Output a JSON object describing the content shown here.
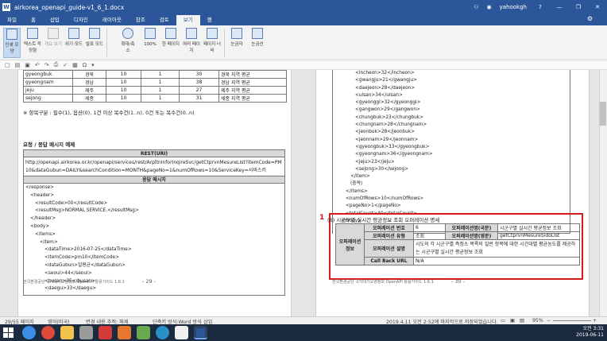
{
  "window": {
    "title": "airkorea_openapi_guide-v1_6_1.docx",
    "user": "yahookgh",
    "help": "?",
    "minimize": "—",
    "restore": "❐",
    "close": "✕"
  },
  "tabs": [
    "파일",
    "홈",
    "삽입",
    "디자인",
    "레이아웃",
    "참조",
    "검토",
    "보기",
    "펜"
  ],
  "ribbon": {
    "buttons": [
      {
        "label": "인쇄 모양",
        "state": "active"
      },
      {
        "label": "텍스트 작정형",
        "state": ""
      },
      {
        "label": "개요 보기",
        "state": "dim"
      },
      {
        "label": "위기 모드",
        "state": ""
      },
      {
        "label": "발표 모드",
        "state": ""
      },
      {
        "label": "확대/축소",
        "state": ""
      },
      {
        "label": "100%",
        "state": ""
      },
      {
        "label": "한 페이지",
        "state": ""
      },
      {
        "label": "여러 페이지",
        "state": ""
      },
      {
        "label": "페이지 너비",
        "state": ""
      },
      {
        "label": "눈금자",
        "state": ""
      },
      {
        "label": "눈금선",
        "state": ""
      }
    ]
  },
  "toptable": {
    "rows": [
      [
        "gyeongbuk",
        "경북",
        "10",
        "1",
        "30",
        "경북 지역 평균"
      ],
      [
        "gyeongnam",
        "경남",
        "10",
        "1",
        "38",
        "경남 지역 평균"
      ],
      [
        "jeju",
        "제주",
        "10",
        "1",
        "27",
        "제주 지역 평균"
      ],
      [
        "sejong",
        "세종",
        "10",
        "1",
        "31",
        "세종 지역 평균"
      ]
    ]
  },
  "page1": {
    "note": "※ 항목구분 : 필수(1), 옵션(0), 1건 이상 복수건(1..n), 0건 또는 복수건(0..n)",
    "heading": "요청 / 응답 메시지 예제",
    "rest_header": "REST(URI)",
    "url": "http://openapi.airkorea.or.kr/openapi/services/rest/ArpltnInforInqireSvc/getCtprvnMesureLIst?itemCode=PM10&dataGubun=DAILY&searchCondition=MONTH&pageNo=1&numOfRows=10&ServiceKey=서비스키",
    "resp_header": "응답 메시지",
    "response": [
      "<response>",
      "  <header>",
      "    <resultCode>00</resultCode>",
      "    <resultMsg>NORMAL SERVICE.</resultMsg>",
      "  </header>",
      "  <body>",
      "    <items>",
      "      <item>",
      "        <dataTime>2016-07-25</dataTime>",
      "        <itemCode>pm10</itemCode>",
      "        <dataGubun>일평균</dataGubun>",
      "        <seoul>44</seoul>",
      "        <busan>35</busan>",
      "        <daegu>33</daegu>"
    ],
    "footer": "한국환경공단 국가대기오염정보 OpenAPI 활용가이드 1.6.1",
    "page_number": "- 29 -"
  },
  "page2": {
    "xml": [
      "      <incheon>32</incheon>",
      "      <gwangju>21</gwangju>",
      "      <daejeon>28</daejeon>",
      "      <ulsan>34</ulsan>",
      "      <gyeonggi>32</gyeonggi>",
      "      <gangwon>29</gangwon>",
      "      <chungbuk>23</chungbuk>",
      "      <chungnam>28</chungnam>",
      "      <jeonbuk>28</jeonbuk>",
      "      <jeonnam>29</jeonnam>",
      "      <gyeongbuk>33</gyeongbuk>",
      "      <gyeongnam>36</gyeongnam>",
      "      <jeju>23</jeju>",
      "      <sejong>30</sejong>",
      "    </item>",
      "    (중략)",
      "  </items>",
      "  <numOfRows>10</numOfRows>",
      "  <pageNo>1</pageNo>",
      "  <totalCount>40</totalCount>",
      "  </body>",
      "</response>"
    ],
    "marker": "1",
    "section_title": "(6) 시군구별 실시간 평균정보 조회 오퍼레이션 명세",
    "op_info_label": "오퍼레이션 정보",
    "op_number_label": "오퍼레이션 번호",
    "op_number": "6",
    "op_name_kr_label": "오퍼레이션명(국문)",
    "op_name_kr": "시군구별 실시간 평균정보 조회",
    "op_type_label": "오퍼레이션 유형",
    "op_type": "조회",
    "op_name_en_label": "오퍼레이션명(영문)",
    "op_name_en": "getCtprvnMesureSidoLIst",
    "op_desc_label": "오퍼레이션 설명",
    "op_desc": "시도의 각 시군구별 측정소 목록의 일반 항목에 대한 시간대별 평균농도를 제공하는 시군구별 실시간 평균정보 조회",
    "callback_label": "Call Back URL",
    "callback": "N/A",
    "footer": "한국환경공단 국가대기오염정보 OpenAPI 활용가이드 1.6.1",
    "page_number": "- 30 -"
  },
  "statusbar": {
    "page": "29/55 페이지",
    "language": "영어(미국)",
    "track": "변경 내용 추적: 해제",
    "compat": "단축키 방식:Word 방식",
    "insert": "삽입",
    "saved": "2019.4.11 오전 2:52에 마지막으로 저장되었습니다.",
    "zoom": "95%",
    "zoom_minus": "−",
    "zoom_plus": "+"
  },
  "taskbar": {
    "time": "오전 3:31",
    "date": "2019-06-11"
  }
}
